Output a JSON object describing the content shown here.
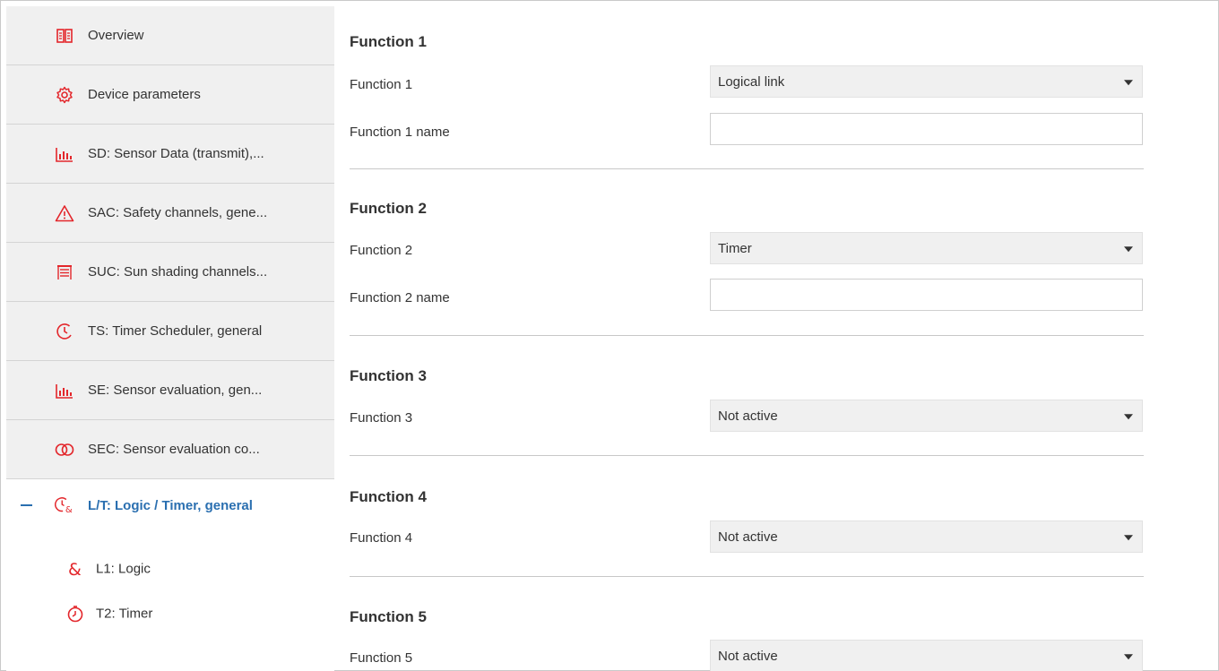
{
  "sidebar": {
    "items": [
      {
        "label": "Overview",
        "icon": "book-icon"
      },
      {
        "label": "Device parameters",
        "icon": "gear-icon"
      },
      {
        "label": "SD: Sensor Data (transmit),...",
        "icon": "bar-chart-icon"
      },
      {
        "label": "SAC: Safety channels, gene...",
        "icon": "warning-icon"
      },
      {
        "label": "SUC: Sun shading channels...",
        "icon": "blind-icon"
      },
      {
        "label": "TS: Timer Scheduler, general",
        "icon": "clock-icon"
      },
      {
        "label": "SE: Sensor evaluation, gen...",
        "icon": "bar-chart-icon"
      },
      {
        "label": "SEC: Sensor evaluation co...",
        "icon": "linked-circles-icon"
      },
      {
        "label": "L/T: Logic / Timer, general",
        "icon": "clock-logic-icon",
        "active": true
      }
    ],
    "sub_items": [
      {
        "label": "L1:  Logic",
        "icon": "ampersand-icon"
      },
      {
        "label": "T2:  Timer",
        "icon": "stopwatch-icon"
      }
    ]
  },
  "main": {
    "sections": [
      {
        "title": "Function 1",
        "select_label": "Function 1",
        "select_value": "Logical link",
        "name_label": "Function 1 name",
        "name_value": ""
      },
      {
        "title": "Function 2",
        "select_label": "Function 2",
        "select_value": "Timer",
        "name_label": "Function 2 name",
        "name_value": ""
      },
      {
        "title": "Function 3",
        "select_label": "Function 3",
        "select_value": "Not active"
      },
      {
        "title": "Function 4",
        "select_label": "Function 4",
        "select_value": "Not active"
      },
      {
        "title": "Function 5",
        "select_label": "Function 5",
        "select_value": "Not active"
      }
    ]
  },
  "colors": {
    "icon_red": "#e3262b",
    "active_blue": "#2a6fb0",
    "sidebar_bg": "#f0f0f0"
  }
}
